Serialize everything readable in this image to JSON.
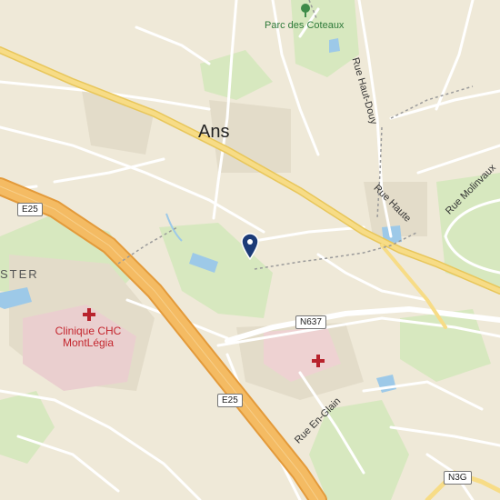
{
  "map": {
    "place_labels": {
      "town": "Ans",
      "park": "Parc des Coteaux",
      "clinic_line1": "Clinique CHC",
      "clinic_line2": "MontLégia",
      "partial_left": "STER"
    },
    "street_labels": {
      "rue_haut_douy": "Rue Haut-Douy",
      "rue_haute": "Rue Haute",
      "rue_molinvaux": "Rue Molinvaux",
      "rue_en_glain": "Rue En-Glain"
    },
    "road_shields": {
      "e25_top": "E25",
      "e25_bottom": "E25",
      "n637": "N637",
      "n3g": "N3G"
    },
    "icons": {
      "location_pin": "map-pin-icon",
      "hospital_cross": "hospital-cross-icon",
      "tree": "tree-icon"
    },
    "colors": {
      "background": "#efe9d8",
      "motorway": "#f0b45a",
      "main_road": "#f7d77a",
      "water": "#9dc9e8",
      "park": "#cfe5b3",
      "pin": "#1c3b77",
      "hospital": "#b8232d"
    }
  }
}
